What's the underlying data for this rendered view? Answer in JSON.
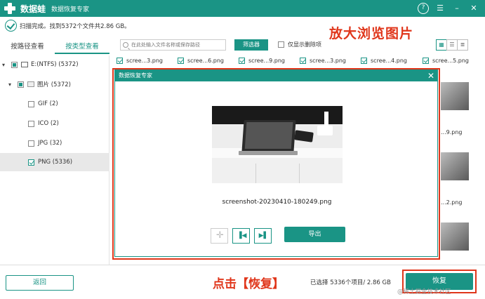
{
  "app": {
    "name": "数据蛙",
    "subtitle": "数据恢复专家",
    "titlebar_icons": [
      "help-icon",
      "menu-icon",
      "minimize-icon",
      "close-icon"
    ],
    "accent_color": "#1a9485"
  },
  "status": {
    "text": "扫描完成。找到5372个文件共2.86 GB。"
  },
  "annotations": {
    "top": "放大浏览图片",
    "bottom": "点击【恢复】"
  },
  "tabs": [
    {
      "label": "按路径查看",
      "active": false
    },
    {
      "label": "按类型查看",
      "active": true
    }
  ],
  "tree": {
    "drive": "E:(NTFS) (5372)",
    "images": "图片 (5372)",
    "types": [
      {
        "label": "GIF (2)",
        "checked": false
      },
      {
        "label": "ICO (2)",
        "checked": false
      },
      {
        "label": "JPG (32)",
        "checked": false
      },
      {
        "label": "PNG (5336)",
        "checked": true
      }
    ]
  },
  "toolbar": {
    "search_placeholder": "在此处输入文件名称或保存路径",
    "filter_label": "筛选器",
    "show_deleted_label": "仅显示删除项"
  },
  "files": {
    "top_labels": [
      "scree...3.png",
      "scree...6.png",
      "scree...9.png",
      "scree...3.png",
      "scree...4.png",
      "scree...5.png"
    ],
    "side_labels": [
      "...9.png",
      "...2.png"
    ]
  },
  "preview": {
    "title": "数据恢复专家",
    "filename": "screenshot-20230410-180249.png",
    "export_label": "导出"
  },
  "footer": {
    "back_label": "返回",
    "selected_info": "已选择 5336个项目/ 2.86 GB",
    "recover_label": "恢复",
    "watermark": "@稀土掘金技术社区"
  }
}
